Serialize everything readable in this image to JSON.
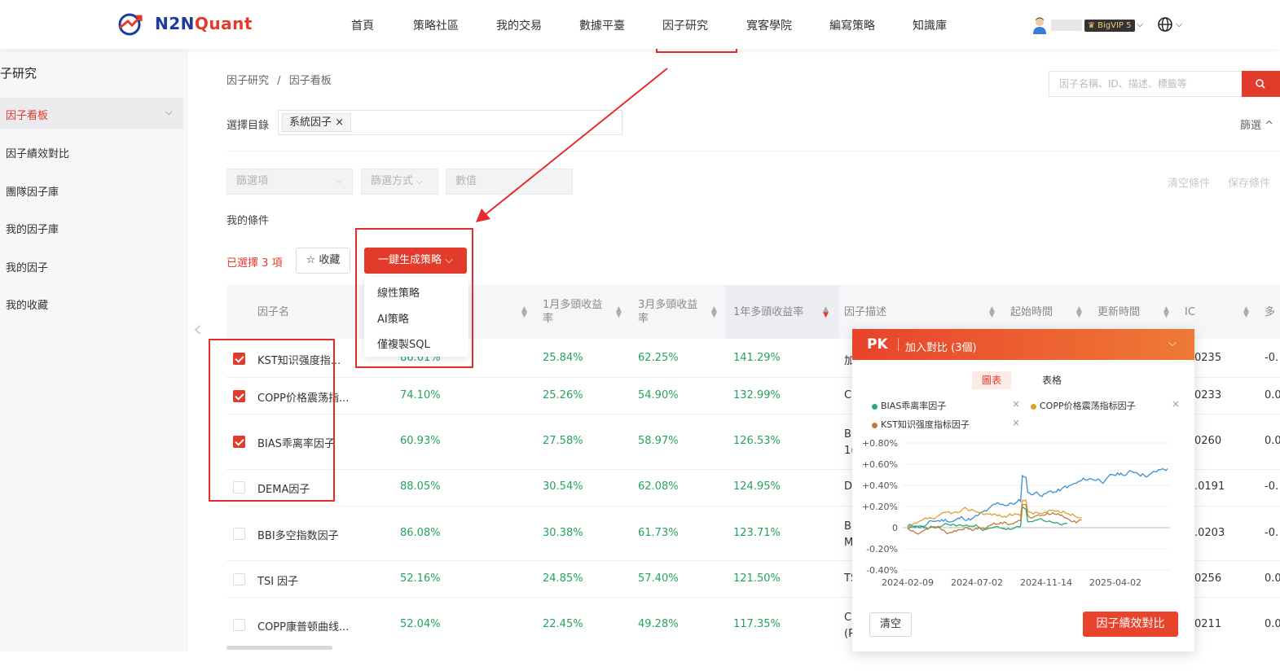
{
  "header": {
    "brand_a": "N2N",
    "brand_b": "Quant",
    "nav": [
      "首頁",
      "策略社區",
      "我的交易",
      "數據平臺",
      "因子研究",
      "寬客學院",
      "編寫策略",
      "知識庫"
    ],
    "vip_badge": "BigVIP 5"
  },
  "sidebar": {
    "title": "子研究",
    "items": [
      "因子看板",
      "因子績效對比",
      "團隊因子庫",
      "我的因子庫",
      "我的因子",
      "我的收藏"
    ]
  },
  "breadcrumb": {
    "root": "因子研究",
    "sep": "/",
    "current": "因子看板"
  },
  "search": {
    "placeholder": "因子名稱、ID、描述、標籤等"
  },
  "filters": {
    "dir_label": "選擇目錄",
    "dir_tag": "系統因子 ×",
    "toggle": "篩選 ^",
    "filter_item": "篩選項",
    "filter_mode": "篩選方式",
    "value": "數值",
    "clear": "清空條件",
    "save": "保存條件",
    "my_conditions": "我的條件"
  },
  "actions": {
    "selected": "已選擇 3 項",
    "favorite": "☆ 收藏",
    "generate": "一鍵生成策略 ⌵",
    "menu": [
      "線性策略",
      "AI策略",
      "僅複製SQL"
    ]
  },
  "table": {
    "columns": [
      "因子名",
      "",
      "1月多頭收益\n率",
      "3月多頭收益\n率",
      "1年多頭收益率",
      "因子描述",
      "起始時間",
      "更新時間",
      "IC",
      "多"
    ],
    "rows": [
      {
        "checked": true,
        "name": "KST知识强度指...",
        "c1": "86.61%",
        "m1": "25.84%",
        "m3": "62.25%",
        "y1": "141.29%",
        "desc": "加",
        "ic": "0235",
        "last": "-0."
      },
      {
        "checked": true,
        "name": "COPP价格震荡指...",
        "c1": "74.10%",
        "m1": "25.26%",
        "m3": "54.90%",
        "y1": "132.99%",
        "desc": "C(",
        "ic": "0233",
        "last": "0.0"
      },
      {
        "checked": true,
        "name": "BIAS乖离率因子",
        "c1": "60.93%",
        "m1": "27.58%",
        "m3": "58.97%",
        "y1": "126.53%",
        "desc": "BI\n1(",
        "ic": "0260",
        "last": "0.0"
      },
      {
        "checked": false,
        "name": "DEMA因子",
        "c1": "88.05%",
        "m1": "30.54%",
        "m3": "62.08%",
        "y1": "124.95%",
        "desc": "D",
        "ic": ".0191",
        "last": "-0."
      },
      {
        "checked": false,
        "name": "BBI多空指数因子",
        "c1": "86.08%",
        "m1": "30.38%",
        "m3": "61.73%",
        "y1": "123.71%",
        "desc": "BI\nM",
        "ic": ".0203",
        "last": "-0."
      },
      {
        "checked": false,
        "name": "TSI 因子",
        "c1": "52.16%",
        "m1": "24.85%",
        "m3": "57.40%",
        "y1": "121.50%",
        "desc": "TS",
        "ic": "0256",
        "last": "0.0"
      },
      {
        "checked": false,
        "name": "COPP康普顿曲线...",
        "c1": "52.04%",
        "m1": "22.45%",
        "m3": "49.28%",
        "y1": "117.35%",
        "desc": "C(\n(P",
        "ic": "0211",
        "last": "0.0"
      }
    ]
  },
  "pk": {
    "logo": "PK",
    "title": "加入對比 (3個)",
    "tab_chart": "圖表",
    "tab_table": "表格",
    "legend": [
      {
        "name": "BIAS乖离率因子",
        "color": "#2aa876"
      },
      {
        "name": "COPP价格震荡指标因子",
        "color": "#e0a030"
      },
      {
        "name": "KST知识强度指标因子",
        "color": "#c27a3a"
      }
    ],
    "clear": "清空",
    "compare": "因子績效對比",
    "y_ticks": [
      "+0.80%",
      "+0.60%",
      "+0.40%",
      "+0.20%",
      "0",
      "-0.20%",
      "-0.40%"
    ],
    "x_ticks": [
      "2024-02-09",
      "2024-07-02",
      "2024-11-14",
      "2025-04-02"
    ]
  },
  "colors": {
    "accent": "#e23a2b",
    "positive": "#24a35f",
    "highlight": "#e62b2b"
  }
}
